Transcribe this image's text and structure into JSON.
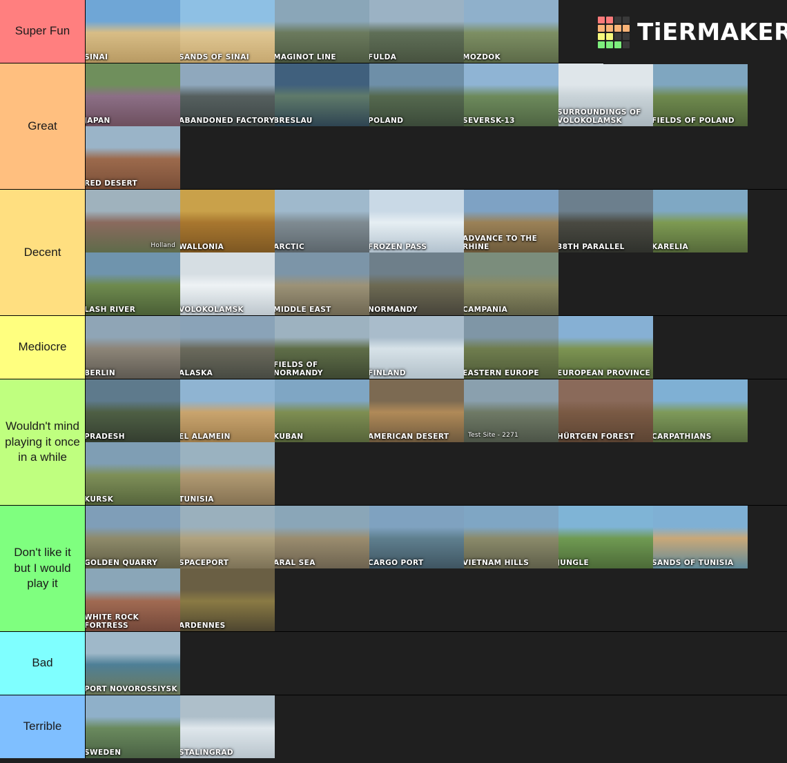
{
  "logo": {
    "text": "TiERMAKER",
    "grid_colors": [
      "#fa7a7a",
      "#fa7a7a",
      "#3a3a3a",
      "#3a3a3a",
      "#f9b377",
      "#f9b377",
      "#f9b377",
      "#f9b377",
      "#f7f87c",
      "#f7f87c",
      "#3a3a3a",
      "#3a3a3a",
      "#7dee7d",
      "#7dee7d",
      "#7dee7d",
      "#3a3a3a"
    ]
  },
  "tiers": [
    {
      "label": "Super Fun",
      "color": "#ff7f7f",
      "items": [
        {
          "name": "SINAI",
          "style": "caps",
          "art": "sinai"
        },
        {
          "name": "SANDS OF SINAI",
          "style": "caps",
          "art": "sands-of-sinai"
        },
        {
          "name": "MAGINOT LINE",
          "style": "caps",
          "art": "maginot-line"
        },
        {
          "name": "FULDA",
          "style": "caps",
          "art": "fulda"
        },
        {
          "name": "MOZDOK",
          "style": "caps",
          "art": "mozdok"
        }
      ]
    },
    {
      "label": "Great",
      "color": "#ffbf7f",
      "items": [
        {
          "name": "JAPAN",
          "style": "caps",
          "art": "japan"
        },
        {
          "name": "ABANDONED FACTORY",
          "style": "caps",
          "art": "abandoned-factory"
        },
        {
          "name": "BRESLAU",
          "style": "caps",
          "art": "breslau"
        },
        {
          "name": "POLAND",
          "style": "caps",
          "art": "poland"
        },
        {
          "name": "SEVERSK-13",
          "style": "caps",
          "art": "seversk-13"
        },
        {
          "name": "SURROUNDINGS OF\nVOLOKOLAMSK",
          "style": "caps",
          "art": "surroundings-volokolamsk"
        },
        {
          "name": "FIELDS OF POLAND",
          "style": "caps",
          "art": "fields-of-poland"
        },
        {
          "name": "RED DESERT",
          "style": "caps",
          "art": "red-desert"
        }
      ]
    },
    {
      "label": "Decent",
      "color": "#ffdf80",
      "items": [
        {
          "name": "Holland",
          "style": "plain-right",
          "art": "holland"
        },
        {
          "name": "WALLONIA",
          "style": "caps",
          "art": "wallonia"
        },
        {
          "name": "ARCTIC",
          "style": "caps",
          "art": "arctic"
        },
        {
          "name": "FROZEN PASS",
          "style": "caps",
          "art": "frozen-pass"
        },
        {
          "name": "ADVANCE TO THE RHINE",
          "style": "caps",
          "art": "advance-to-the-rhine"
        },
        {
          "name": "38TH PARALLEL",
          "style": "caps",
          "art": "38th-parallel"
        },
        {
          "name": "KARELIA",
          "style": "caps",
          "art": "karelia"
        },
        {
          "name": "LASH RIVER",
          "style": "caps",
          "art": "lash-river"
        },
        {
          "name": "VOLOKOLAMSK",
          "style": "caps",
          "art": "volokolamsk"
        },
        {
          "name": "MIDDLE EAST",
          "style": "caps",
          "art": "middle-east"
        },
        {
          "name": "NORMANDY",
          "style": "caps",
          "art": "normandy"
        },
        {
          "name": "CAMPANIA",
          "style": "caps",
          "art": "campania"
        }
      ]
    },
    {
      "label": "Mediocre",
      "color": "#ffff7f",
      "items": [
        {
          "name": "BERLIN",
          "style": "caps",
          "art": "berlin"
        },
        {
          "name": "ALASKA",
          "style": "caps",
          "art": "alaska"
        },
        {
          "name": "FIELDS OF NORMANDY",
          "style": "caps",
          "art": "fields-of-normandy"
        },
        {
          "name": "FINLAND",
          "style": "caps",
          "art": "finland"
        },
        {
          "name": "EASTERN EUROPE",
          "style": "caps",
          "art": "eastern-europe"
        },
        {
          "name": "EUROPEAN PROVINCE",
          "style": "caps",
          "art": "european-province"
        }
      ]
    },
    {
      "label": "Wouldn't mind playing it once in a while",
      "color": "#bfff7f",
      "items": [
        {
          "name": "PRADESH",
          "style": "caps",
          "art": "pradesh"
        },
        {
          "name": "EL ALAMEIN",
          "style": "caps",
          "art": "el-alamein"
        },
        {
          "name": "KUBAN",
          "style": "caps",
          "art": "kuban"
        },
        {
          "name": "AMERICAN DESERT",
          "style": "caps",
          "art": "american-desert"
        },
        {
          "name": "Test Site - 2271",
          "style": "plain-left",
          "art": "test-site-2271"
        },
        {
          "name": "HÜRTGEN FOREST",
          "style": "caps",
          "art": "hurtgen-forest"
        },
        {
          "name": "CARPATHIANS",
          "style": "caps",
          "art": "carpathians"
        },
        {
          "name": "KURSK",
          "style": "caps",
          "art": "kursk"
        },
        {
          "name": "TUNISIA",
          "style": "caps",
          "art": "tunisia"
        }
      ]
    },
    {
      "label": "Don't like it but I would play it",
      "color": "#7fff7f",
      "items": [
        {
          "name": "GOLDEN QUARRY",
          "style": "caps",
          "art": "golden-quarry"
        },
        {
          "name": "SPACEPORT",
          "style": "caps",
          "art": "spaceport"
        },
        {
          "name": "ARAL SEA",
          "style": "caps",
          "art": "aral-sea"
        },
        {
          "name": "CARGO PORT",
          "style": "caps",
          "art": "cargo-port"
        },
        {
          "name": "VIETNAM HILLS",
          "style": "caps",
          "art": "vietnam-hills"
        },
        {
          "name": "JUNGLE",
          "style": "caps",
          "art": "jungle"
        },
        {
          "name": "SANDS OF TUNISIA",
          "style": "caps",
          "art": "sands-of-tunisia"
        },
        {
          "name": "WHITE ROCK FORTRESS",
          "style": "caps",
          "art": "white-rock-fortress"
        },
        {
          "name": "ARDENNES",
          "style": "caps",
          "art": "ardennes"
        }
      ]
    },
    {
      "label": "Bad",
      "color": "#7fffff",
      "items": [
        {
          "name": "PORT NOVOROSSIYSK",
          "style": "caps",
          "art": "port-novorossiysk"
        }
      ]
    },
    {
      "label": "Terrible",
      "color": "#7fbfff",
      "items": [
        {
          "name": "SWEDEN",
          "style": "caps",
          "art": "sweden"
        },
        {
          "name": "STALINGRAD",
          "style": "caps",
          "art": "stalingrad"
        }
      ]
    }
  ]
}
